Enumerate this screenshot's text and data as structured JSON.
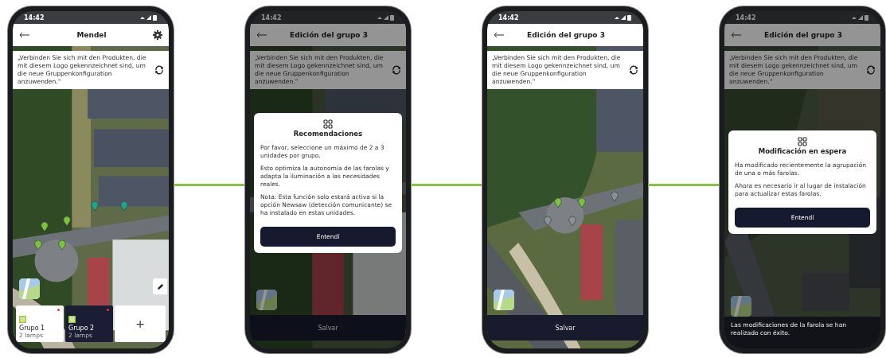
{
  "phones": [
    {
      "time": "14:42",
      "title": "Mendel",
      "settings": true,
      "banner": "„Verbinden Sie sich mit den Produkten, die mit diesem Logo gekennzeichnet sind, um die neue Gruppenkonfiguration anzuwenden.“",
      "dimmed": false,
      "edit_button": true,
      "pins": [
        {
          "color": "#7cc242"
        },
        {
          "color": "#7cc242"
        },
        {
          "color": "#1fa38f"
        },
        {
          "color": "#1fa38f"
        },
        {
          "color": "#7cc242"
        },
        {
          "color": "#7cc242"
        }
      ],
      "bottom": {
        "kind": "groups",
        "groups": [
          {
            "name": "Grupo 1",
            "count": "2 lamps",
            "selected": false,
            "pending": true
          },
          {
            "name": "Grupo 2",
            "count": "2 lamps",
            "selected": true,
            "pending": true
          }
        ],
        "add_label": "+"
      }
    },
    {
      "time": "14:42",
      "title": "Edición del grupo 3",
      "banner": "„Verbinden Sie sich mit den Produkten, die mit diesem Logo gekennzeichnet sind, um die neue Gruppenkonfiguration anzuwenden.“",
      "dimmed": true,
      "dialog": {
        "title": "Recomendaciones",
        "paragraphs": [
          "Por favor, seleccione un máximo de 2 a 3 unidades por grupo.",
          "Esto optimiza la autonomía de las farolas y adapta la iluminación a las necesidades reales.",
          "Nota: Esta función solo estará activa si la opción Newsaw (detección comunicante) se ha instalado en estas unidades."
        ],
        "button": "Entendí"
      },
      "bottom": {
        "kind": "save",
        "label": "Salvar"
      }
    },
    {
      "time": "14:42",
      "title": "Edición del grupo 3",
      "banner": "„Verbinden Sie sich mit den Produkten, die mit diesem Logo gekennzeichnet sind, um die neue Gruppenkonfiguration anzuwenden.“",
      "dimmed": false,
      "pins": [
        {
          "color": "#7cc242"
        },
        {
          "color": "#7cc242"
        },
        {
          "color": "#8a9099"
        },
        {
          "color": "#8a9099"
        },
        {
          "color": "#8a9099"
        }
      ],
      "bottom": {
        "kind": "save",
        "label": "Salvar"
      }
    },
    {
      "time": "14:42",
      "title": "Edición del grupo 3",
      "banner": "„Verbinden Sie sich mit den Produkten, die mit diesem Logo gekennzeichnet sind, um die neue Gruppenkonfiguration anzuwenden.“",
      "dimmed": true,
      "dialog": {
        "title": "Modificación en espera",
        "paragraphs": [
          "Ha modificado recientemente la agrupación de una o más farolas.",
          "Ahora es necesario ir al lugar de instalación para actualizar estas farolas."
        ],
        "button": "Entendí"
      },
      "bottom": {
        "kind": "snackbar",
        "text": "Las modificaciones de la farola se han realizado con éxito."
      }
    }
  ]
}
